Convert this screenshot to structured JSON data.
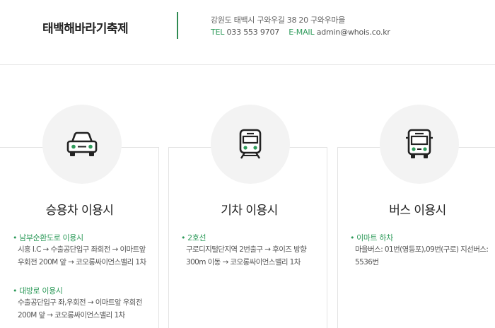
{
  "header": {
    "title": "태백해바라기축제",
    "address": "강원도 태백시 구와우길 38 20 구와우마을",
    "tel_label": "TEL",
    "tel": "033 553 9707",
    "email_label": "E-MAIL",
    "email": "admin@whois.co.kr"
  },
  "colors": {
    "accent": "#2f9b5b",
    "divider": "#2f8a52",
    "circle": "#f3f3f3"
  },
  "cards": [
    {
      "icon": "car-icon",
      "title": "승용차 이용시",
      "routes": [
        {
          "head": "남부순환도로 이용시",
          "lines": [
            "시흥 I.C → 수출공단입구 좌회전 → 이마트앞",
            "우회전 200M 앞 → 코오롱싸이언스밸리 1차"
          ]
        },
        {
          "head": "대방로 이용시",
          "lines": [
            "수출공단입구 좌,우회전 → 이마트앞 우회전",
            "200M 앞 → 코오롱싸이언스밸리 1차"
          ]
        }
      ]
    },
    {
      "icon": "train-icon",
      "title": "기차 이용시",
      "routes": [
        {
          "head": "2호선",
          "lines": [
            "구로디지털단지역 2번출구 → 후이즈 방향",
            "300m 이동 → 코오롱싸이언스밸리 1차"
          ]
        }
      ]
    },
    {
      "icon": "bus-icon",
      "title": "버스 이용시",
      "routes": [
        {
          "head": "이마트 하차",
          "lines": [
            "마을버스: 01번(영등포),09번(구로) 지선버스:",
            "5536번"
          ]
        }
      ]
    }
  ]
}
